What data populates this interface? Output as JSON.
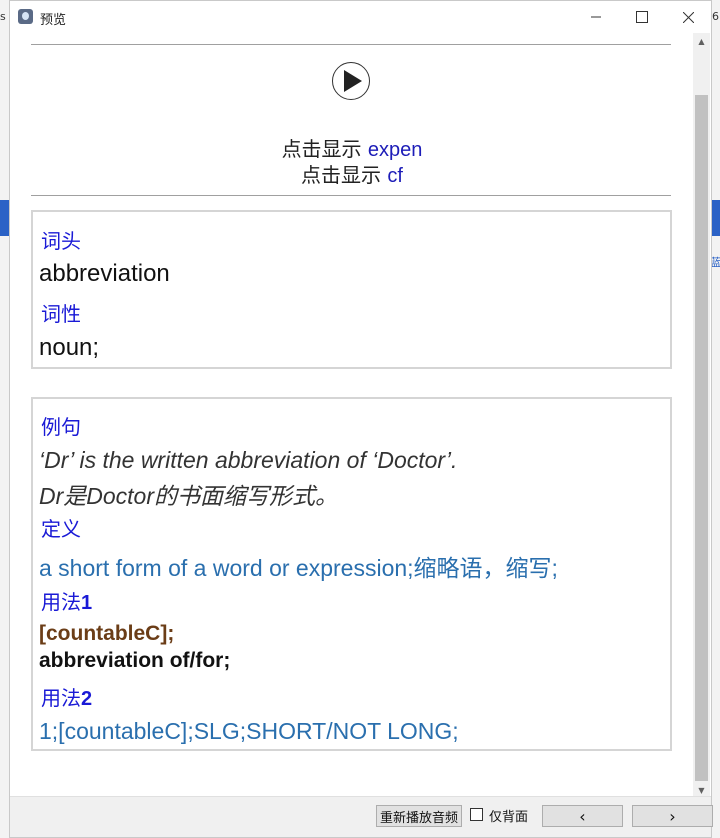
{
  "window": {
    "title": "预览"
  },
  "background": {
    "glyph_top": "s",
    "glyph_top2": "6",
    "glyph_mid": "蓝"
  },
  "media": {
    "play_icon": "play-icon"
  },
  "reveal": {
    "line1_prefix": "点击显示 ",
    "line1_value": "expen",
    "line2_prefix": "点击显示 ",
    "line2_value": "cf"
  },
  "entry": {
    "headword_label": "词头",
    "headword": "abbreviation",
    "pos_label": "词性",
    "pos": "noun;"
  },
  "details": {
    "example_label": "例句",
    "example_en": "‘Dr’ is the written abbreviation of ‘Doctor’.",
    "example_zh": "Dr是Doctor的书面缩写形式。",
    "definition_label": "定义",
    "definition": "a short form of a word or expression;缩略语，缩写;",
    "usage1_label": "用法",
    "usage1_num": "1",
    "usage1_grammar": "[countableC];",
    "usage1_pattern": "abbreviation of/for;",
    "usage2_label": "用法",
    "usage2_num": "2",
    "usage2_text": "1;[countableC];SLG;SHORT/NOT LONG;"
  },
  "statusbar": {
    "replay_label": "重新播放音频",
    "back_only_label": "仅背面",
    "back_only_checked": false,
    "prev_label": "‹",
    "next_label": "›"
  }
}
